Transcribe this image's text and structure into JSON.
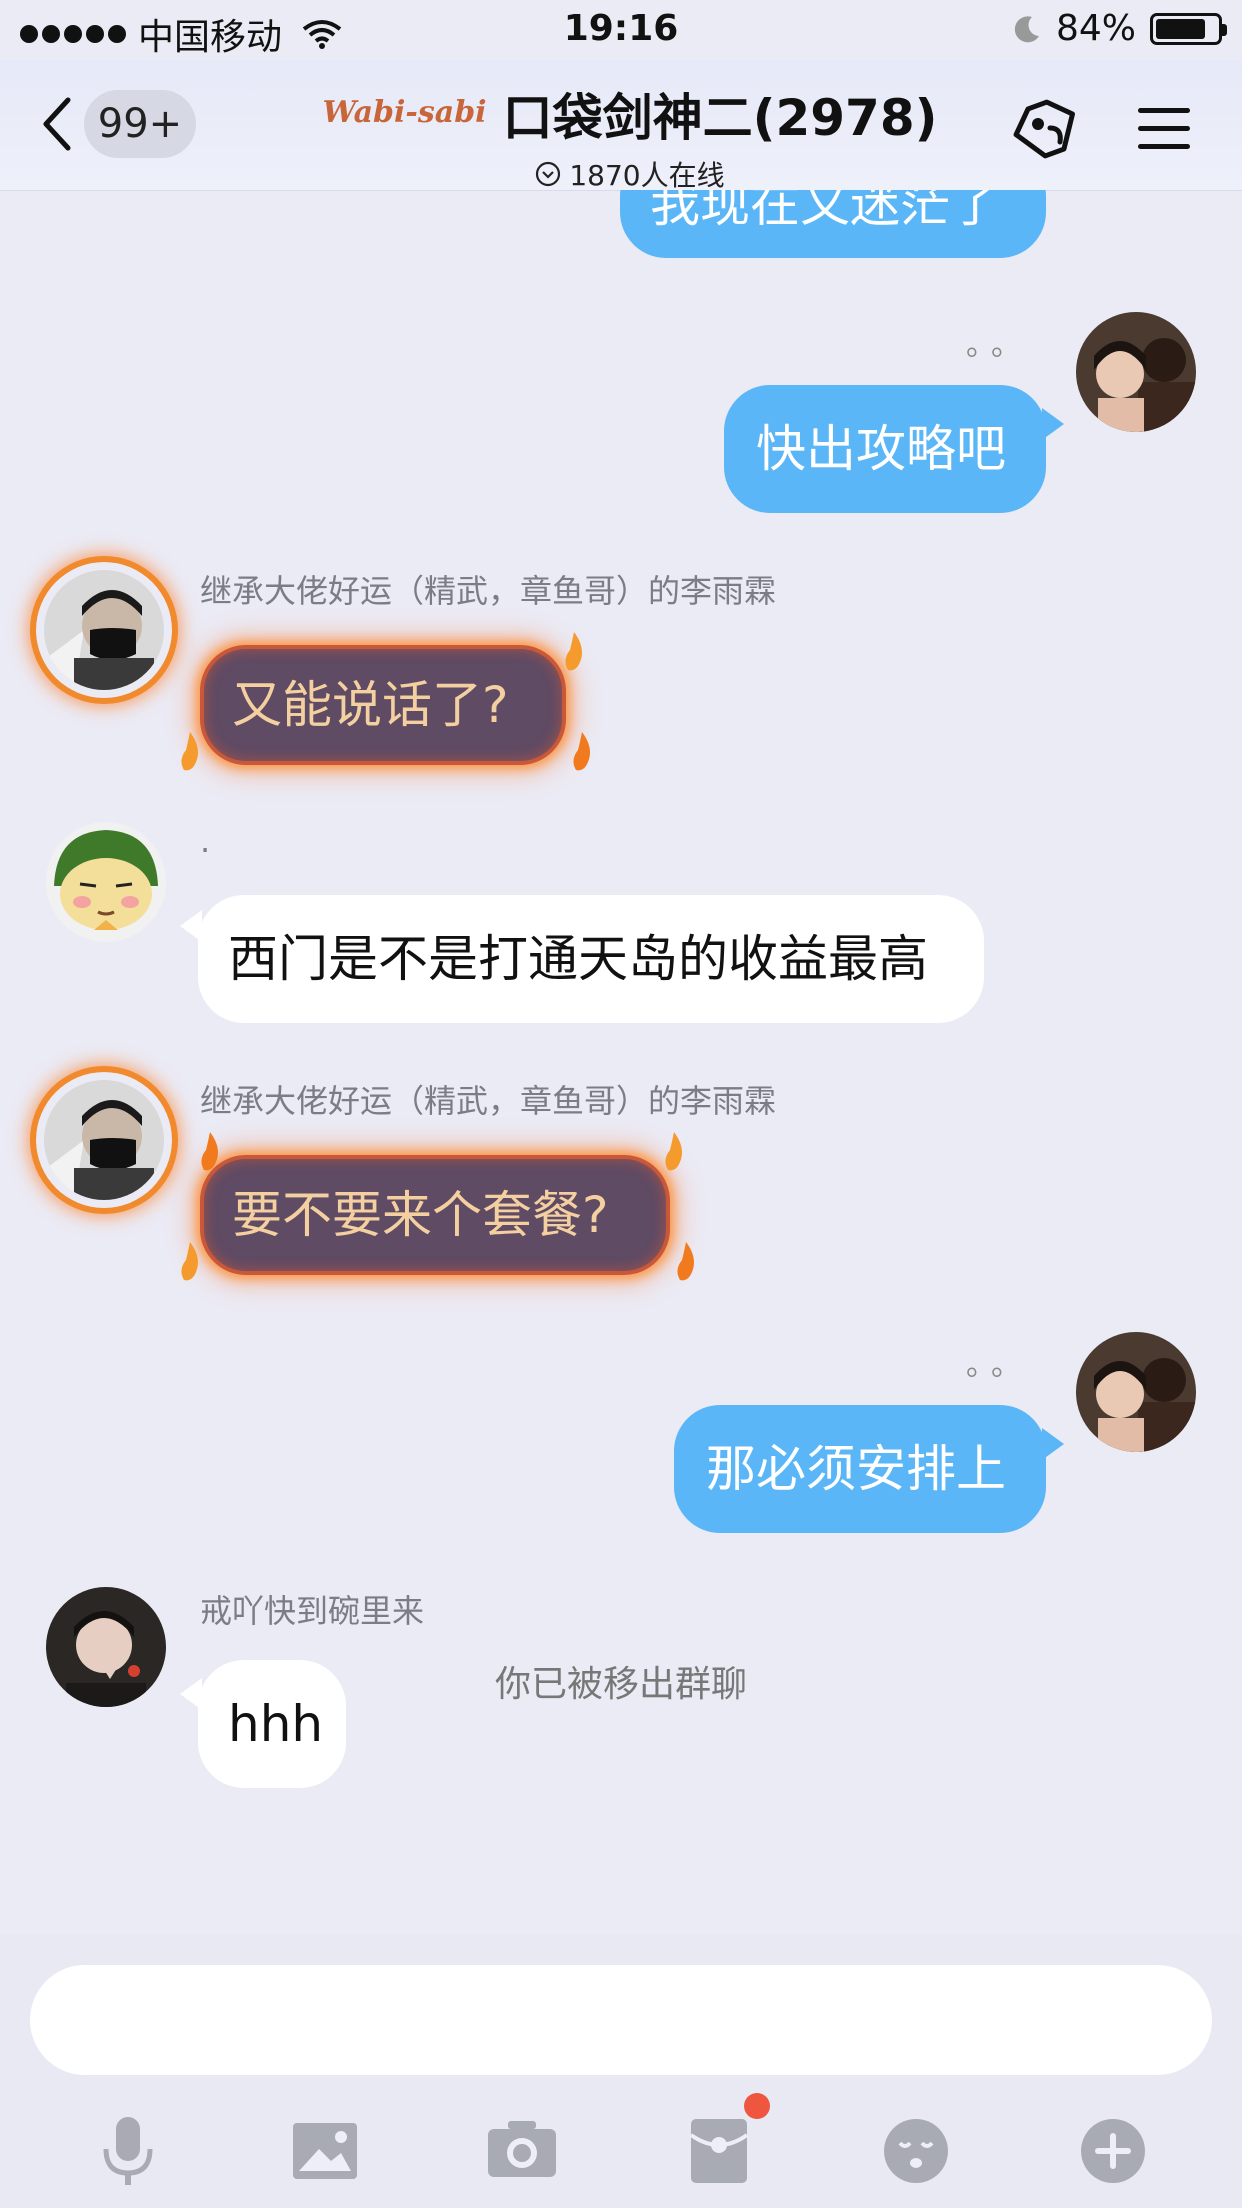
{
  "status_bar": {
    "carrier": "中国移动",
    "time": "19:16",
    "battery": "84%",
    "battery_level": 0.84
  },
  "nav": {
    "back_badge": "99+",
    "brand": "Wabi-sabi",
    "title": "口袋剑神二(2978)",
    "online": "1870人在线"
  },
  "messages": [
    {
      "side": "right",
      "text": "我现在又迷茫了",
      "style": "blue"
    },
    {
      "side": "right",
      "text": "快出攻略吧",
      "style": "blue",
      "typing": "。。"
    },
    {
      "side": "left",
      "sender": "继承大佬好运（精武，章鱼哥）的李雨霖",
      "text": "又能说话了?",
      "style": "fire"
    },
    {
      "side": "left",
      "sender": ".",
      "text": "西门是不是打通天岛的收益最高",
      "style": "white"
    },
    {
      "side": "left",
      "sender": "继承大佬好运（精武，章鱼哥）的李雨霖",
      "text": "要不要来个套餐?",
      "style": "fire"
    },
    {
      "side": "right",
      "text": "那必须安排上",
      "style": "blue",
      "typing": "。。"
    },
    {
      "side": "left",
      "sender": "戒吖快到碗里来",
      "text": "hhh",
      "style": "white"
    }
  ],
  "system_message": "你已被移出群聊",
  "input": {
    "placeholder": "",
    "value": ""
  },
  "toolbar": {
    "icons": [
      "microphone-icon",
      "image-icon",
      "camera-icon",
      "red-packet-icon",
      "emoji-icon",
      "plus-icon"
    ],
    "notification_color": "#ef5640"
  },
  "colors": {
    "accent_blue": "#5ab6f7",
    "background": "#ebebf5",
    "fire_bubble": "#5f4b64",
    "fire_text": "#f4cf9f"
  }
}
